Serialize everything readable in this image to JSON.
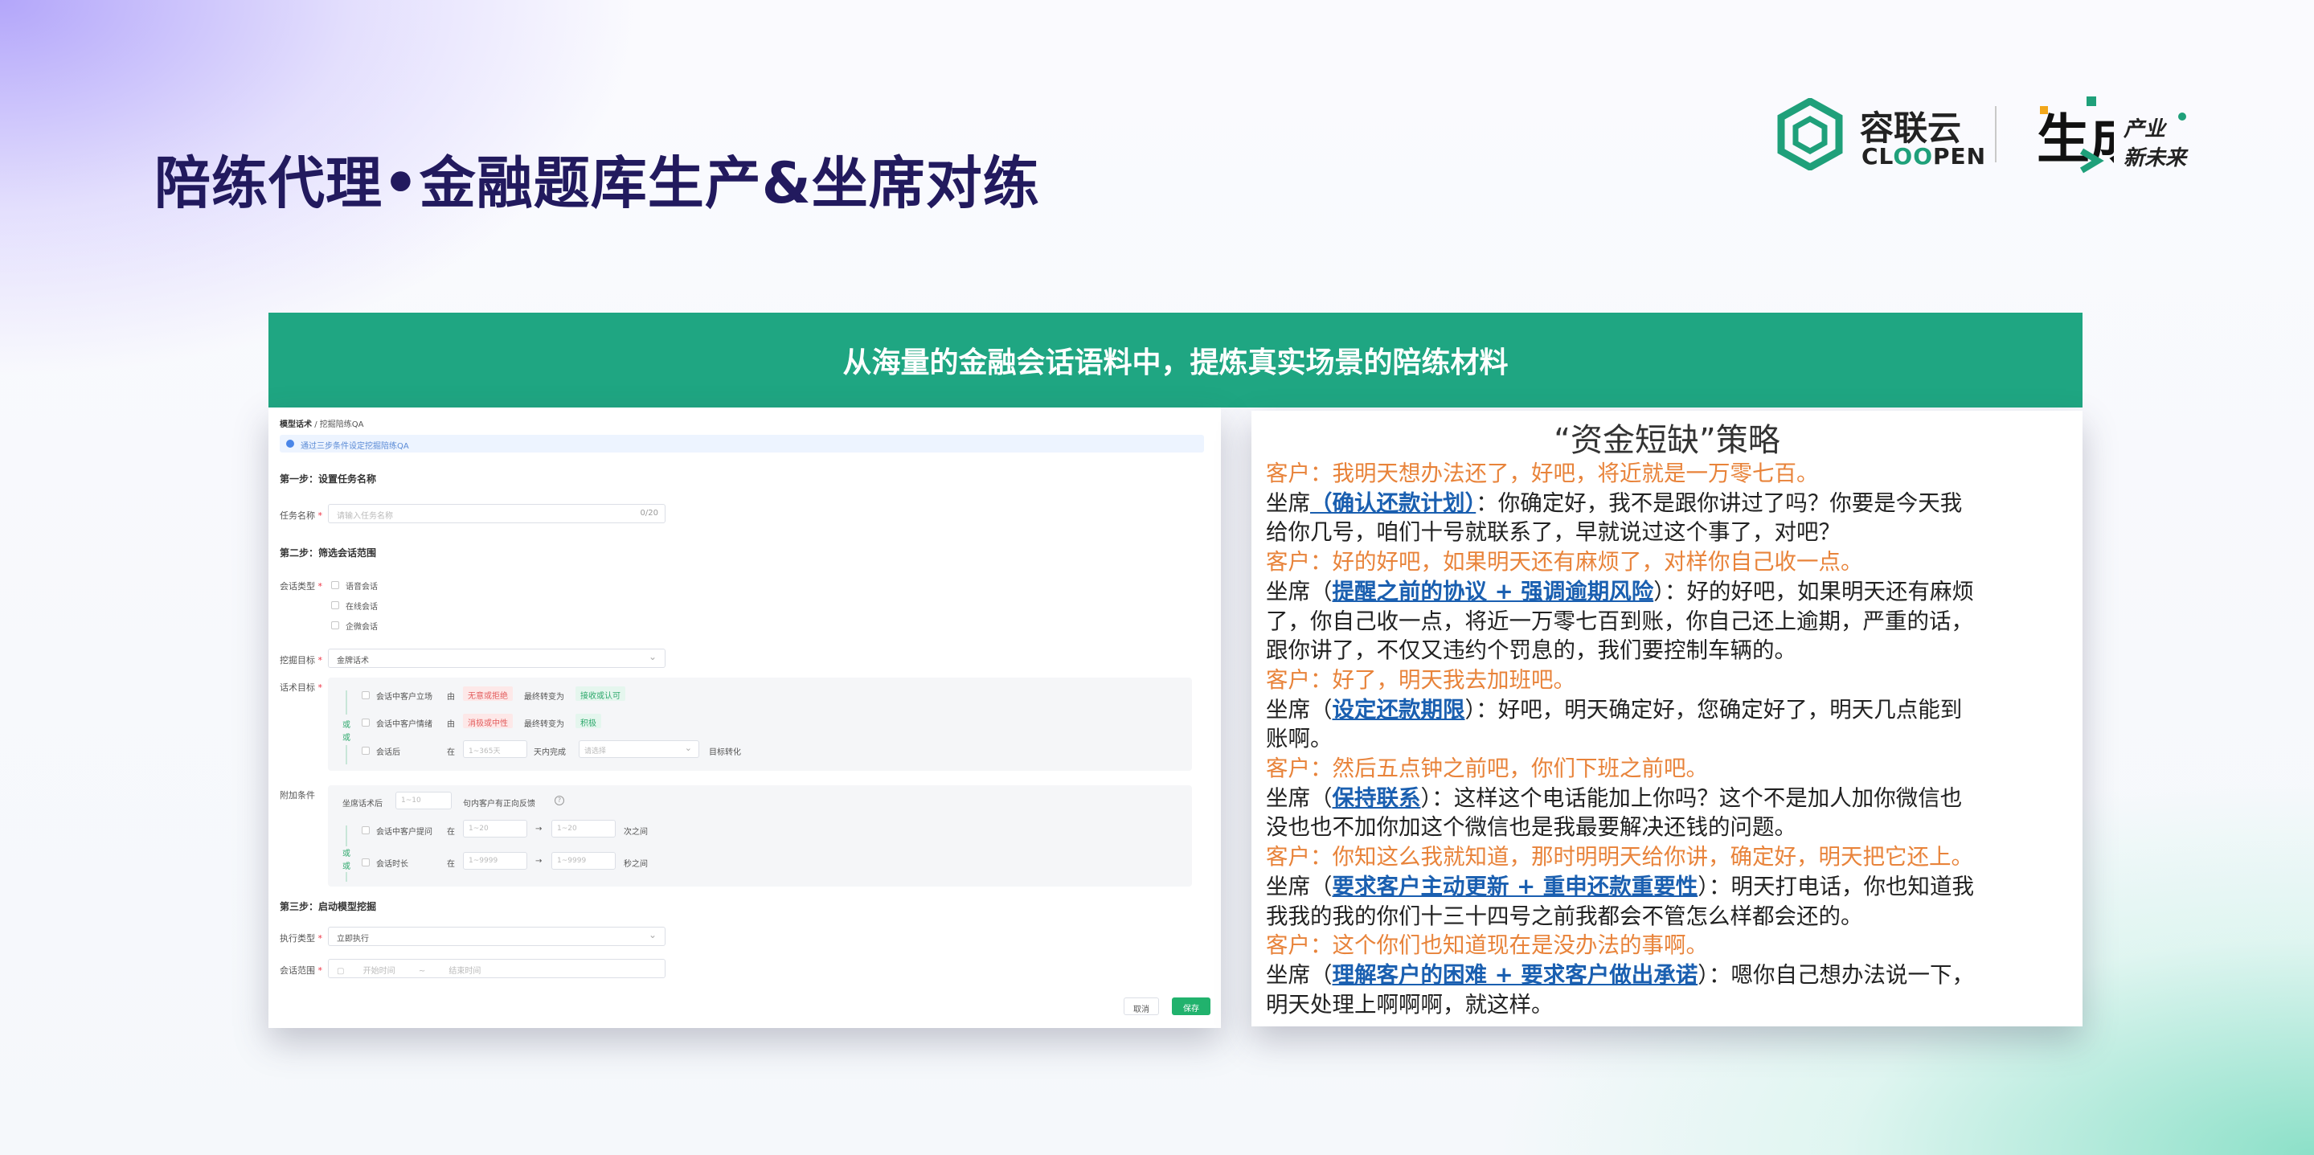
{
  "slide": {
    "title": "陪练代理•金融题库生产&坐席对练"
  },
  "logos": {
    "brand_cn": "容联云",
    "brand_en_pre": "CL",
    "brand_en_oo": "OO",
    "brand_en_post": "PEN",
    "partner_mark": "生成",
    "partner_text1": "产业",
    "partner_text2": "新未来",
    "colors": {
      "green": "#1fa07a",
      "dark": "#222222"
    }
  },
  "banner": {
    "text": "从海量的金融会话语料中，提炼真实场景的陪练材料",
    "color": "#1fa682"
  },
  "form": {
    "breadcrumb_root": "模型话术",
    "breadcrumb_sep": "/",
    "breadcrumb_page": "挖掘陪练QA",
    "notice": "通过三步条件设定挖掘陪练QA",
    "step1": "第一步：设置任务名称",
    "task_name_label": "任务名称",
    "task_name_placeholder": "请输入任务名称",
    "task_name_count": "0/20",
    "step2": "第二步：筛选会话范围",
    "session_type_label": "会话类型",
    "session_types": [
      "语音会话",
      "在线会话",
      "企微会话"
    ],
    "mining_target_label": "挖掘目标",
    "mining_target_value": "金牌话术",
    "script_target_label": "话术目标",
    "or_label": "或",
    "cond1_label": "会话中客户立场",
    "cond1_from": "由",
    "cond1_tag_from": "无意或拒绝",
    "cond1_to": "最终转变为",
    "cond1_tag_to": "接收或认可",
    "cond2_label": "会话中客户情绪",
    "cond2_from": "由",
    "cond2_tag_from": "消极或中性",
    "cond2_to": "最终转变为",
    "cond2_tag_to": "积极",
    "cond3_label": "会话后",
    "cond3_in": "在",
    "cond3_days_placeholder": "1~365天",
    "cond3_done": "天内完成",
    "cond3_select_placeholder": "请选择",
    "cond3_target": "目标转化",
    "extra_label": "附加条件",
    "agent_after_label": "坐席话术后",
    "agent_after_placeholder": "1~10",
    "agent_after_text": "句内客户有正向反馈",
    "cond4_label": "会话中客户提问",
    "cond4_in": "在",
    "cond4_from_placeholder": "1~20",
    "cond4_arrow": "→",
    "cond4_to_placeholder": "1~20",
    "cond4_unit": "次之间",
    "cond5_label": "会话时长",
    "cond5_in": "在",
    "cond5_from_placeholder": "1~9999",
    "cond5_arrow": "→",
    "cond5_to_placeholder": "1~9999",
    "cond5_unit": "秒之间",
    "step3": "第三步：启动模型挖掘",
    "exec_type_label": "执行类型",
    "exec_type_value": "立即执行",
    "session_range_label": "会话范围",
    "start_time_placeholder": "开始时间",
    "range_sep": "~",
    "end_time_placeholder": "结束时间",
    "cancel_button": "取消",
    "save_button": "保存",
    "required_mark": "*"
  },
  "transcript": {
    "title": "“资金短缺”策略",
    "lines": [
      {
        "role": "customer",
        "text": "客户：我明天想办法还了，好吧，将近就是一万零七百。"
      },
      {
        "role": "agent",
        "pre": "坐席",
        "strategy": "（确认还款计划）",
        "post": "：你确定好，我不是跟你讲过了吗？你要是今天我"
      },
      {
        "role": "agent-cont",
        "text": "给你几号，咱们十号就联系了，早就说过这个事了，对吧？"
      },
      {
        "role": "customer",
        "text": "客户：好的好吧，如果明天还有麻烦了，对样你自己收一点。"
      },
      {
        "role": "agent",
        "pre": "坐席（",
        "strategy": "提醒之前的协议 + 强调逾期风险",
        "post": "）：好的好吧，如果明天还有麻烦"
      },
      {
        "role": "agent-cont",
        "text": "了，你自己收一点，将近一万零七百到账，你自己还上逾期，严重的话，"
      },
      {
        "role": "agent-cont",
        "text": "跟你讲了，不仅又违约个罚息的，我们要控制车辆的。"
      },
      {
        "role": "customer",
        "text": "客户：好了，明天我去加班吧。"
      },
      {
        "role": "agent",
        "pre": "坐席（",
        "strategy": "设定还款期限",
        "post": "）：好吧，明天确定好，您确定好了，明天几点能到"
      },
      {
        "role": "agent-cont",
        "text": "账啊。"
      },
      {
        "role": "customer",
        "text": "客户：然后五点钟之前吧，你们下班之前吧。"
      },
      {
        "role": "agent",
        "pre": "坐席（",
        "strategy": "保持联系",
        "post": "）：这样这个电话能加上你吗？这个不是加人加你微信也"
      },
      {
        "role": "agent-cont",
        "text": "没也也不加你加这个微信也是我最要解决还钱的问题。"
      },
      {
        "role": "customer",
        "text": "客户：你知这么我就知道，那时明明天给你讲，确定好，明天把它还上。"
      },
      {
        "role": "agent",
        "pre": "坐席（",
        "strategy": "要求客户主动更新 + 重申还款重要性",
        "post": "）：明天打电话，你也知道我"
      },
      {
        "role": "agent-cont",
        "text": "我我的我的你们十三十四号之前我都会不管怎么样都会还的。"
      },
      {
        "role": "customer",
        "text": "客户：这个你们也知道现在是没办法的事啊。"
      },
      {
        "role": "agent",
        "pre": "坐席（",
        "strategy": "理解客户的困难 + 要求客户做出承诺",
        "post": "）：嗯你自己想办法说一下，"
      },
      {
        "role": "agent-cont",
        "text": "明天处理上啊啊啊，就这样。"
      }
    ],
    "colors": {
      "customer": "#e8833a",
      "agent": "#222222",
      "strategy": "#1a5fb0"
    }
  }
}
